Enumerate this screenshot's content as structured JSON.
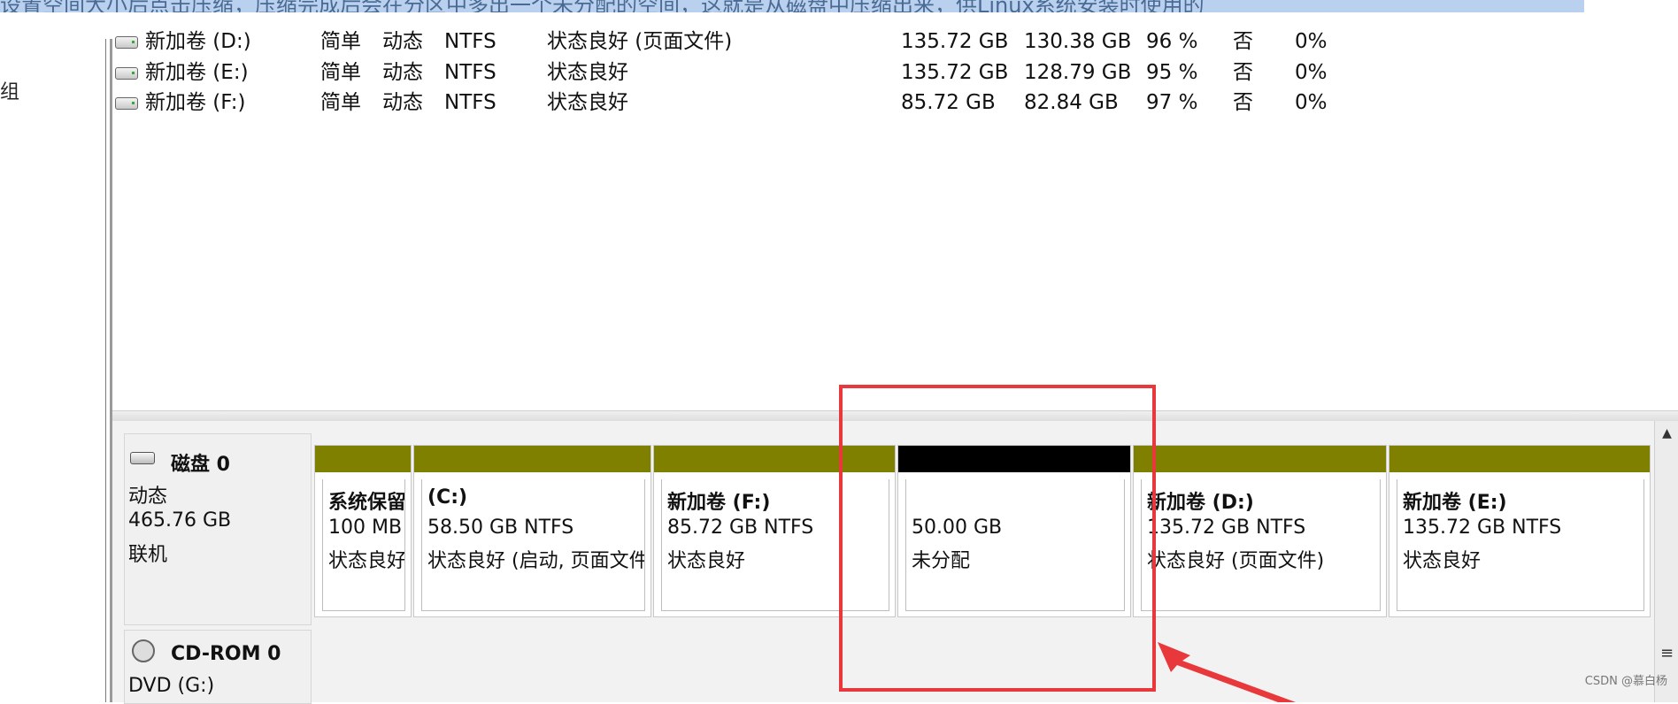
{
  "top_text": "设置空间大小后点击压缩，压缩完成后会在分区中多出一个未分配的空间，这就是从磁盘中压缩出来，供Linux系统安装时使用的",
  "left_glyph": "组",
  "volumes": [
    {
      "name": "新加卷 (D:)",
      "layout": "简单",
      "type": "动态",
      "fs": "NTFS",
      "status": "状态良好 (页面文件)",
      "capacity": "135.72 GB",
      "free": "130.38 GB",
      "pct_free": "96 %",
      "fault_tolerance": "否",
      "overhead": "0%"
    },
    {
      "name": "新加卷 (E:)",
      "layout": "简单",
      "type": "动态",
      "fs": "NTFS",
      "status": "状态良好",
      "capacity": "135.72 GB",
      "free": "128.79 GB",
      "pct_free": "95 %",
      "fault_tolerance": "否",
      "overhead": "0%"
    },
    {
      "name": "新加卷 (F:)",
      "layout": "简单",
      "type": "动态",
      "fs": "NTFS",
      "status": "状态良好",
      "capacity": "85.72 GB",
      "free": "82.84 GB",
      "pct_free": "97 %",
      "fault_tolerance": "否",
      "overhead": "0%"
    }
  ],
  "disk0": {
    "name": "磁盘 0",
    "type": "动态",
    "size": "465.76 GB",
    "state": "联机"
  },
  "partitions": [
    {
      "title": "系统保留",
      "size": "100 MB NTFS",
      "status": "状态良好",
      "bar": "#808000"
    },
    {
      "title": "(C:)",
      "size": "58.50 GB NTFS",
      "status": "状态良好 (启动, 页面文件)",
      "bar": "#808000"
    },
    {
      "title": "新加卷 (F:)",
      "size": "85.72 GB NTFS",
      "status": "状态良好",
      "bar": "#808000"
    },
    {
      "title": "",
      "size": "50.00 GB",
      "status": "未分配",
      "bar": "#000000"
    },
    {
      "title": "新加卷 (D:)",
      "size": "135.72 GB NTFS",
      "status": "状态良好 (页面文件)",
      "bar": "#808000"
    },
    {
      "title": "新加卷 (E:)",
      "size": "135.72 GB NTFS",
      "status": "状态良好",
      "bar": "#808000"
    }
  ],
  "cdrom": {
    "name": "CD-ROM 0",
    "drive": "DVD (G:)"
  },
  "watermark": "CSDN @慕白杨",
  "colors": {
    "primary_partition": "#808000",
    "unallocated": "#000000",
    "annotation": "#e8383b"
  }
}
